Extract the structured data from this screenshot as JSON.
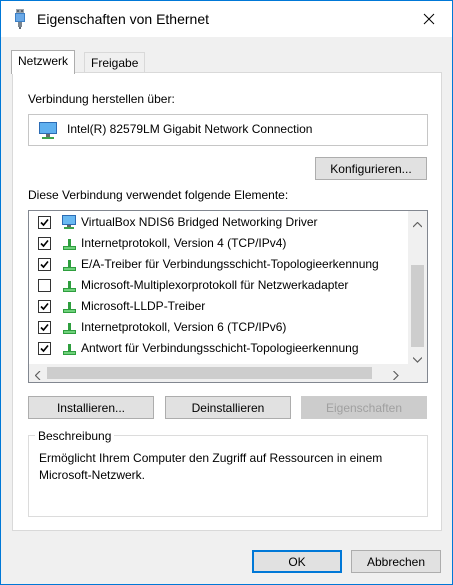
{
  "window": {
    "title": "Eigenschaften von Ethernet",
    "icon": "network-cable-icon",
    "close_icon": "close-icon"
  },
  "tabs": [
    {
      "label": "Netzwerk",
      "active": true
    },
    {
      "label": "Freigabe",
      "active": false
    }
  ],
  "connection": {
    "label": "Verbindung herstellen über:",
    "adapter_name": "Intel(R) 82579LM Gigabit Network Connection",
    "adapter_icon": "network-adapter-icon",
    "configure_button": "Konfigurieren..."
  },
  "components": {
    "label": "Diese Verbindung verwendet folgende Elemente:",
    "items": [
      {
        "checked": true,
        "icon": "virtualbox-adapter-icon",
        "label": "VirtualBox NDIS6 Bridged Networking Driver"
      },
      {
        "checked": true,
        "icon": "protocol-icon",
        "label": "Internetprotokoll, Version 4 (TCP/IPv4)"
      },
      {
        "checked": true,
        "icon": "protocol-icon",
        "label": "E/A-Treiber für Verbindungsschicht-Topologieerkennung"
      },
      {
        "checked": false,
        "icon": "protocol-icon",
        "label": "Microsoft-Multiplexorprotokoll für Netzwerkadapter"
      },
      {
        "checked": true,
        "icon": "protocol-icon",
        "label": "Microsoft-LLDP-Treiber"
      },
      {
        "checked": true,
        "icon": "protocol-icon",
        "label": "Internetprotokoll, Version 6 (TCP/IPv6)"
      },
      {
        "checked": true,
        "icon": "protocol-icon",
        "label": "Antwort für Verbindungsschicht-Topologieerkennung"
      }
    ]
  },
  "actions": {
    "install": "Installieren...",
    "uninstall": "Deinstallieren",
    "properties": "Eigenschaften"
  },
  "description": {
    "title": "Beschreibung",
    "text": "Ermöglicht Ihrem Computer den Zugriff auf Ressourcen in einem Microsoft-Netzwerk."
  },
  "footer": {
    "ok": "OK",
    "cancel": "Abbrechen"
  },
  "colors": {
    "accent": "#0078d7",
    "protocol_green": "#2e9e3e"
  }
}
